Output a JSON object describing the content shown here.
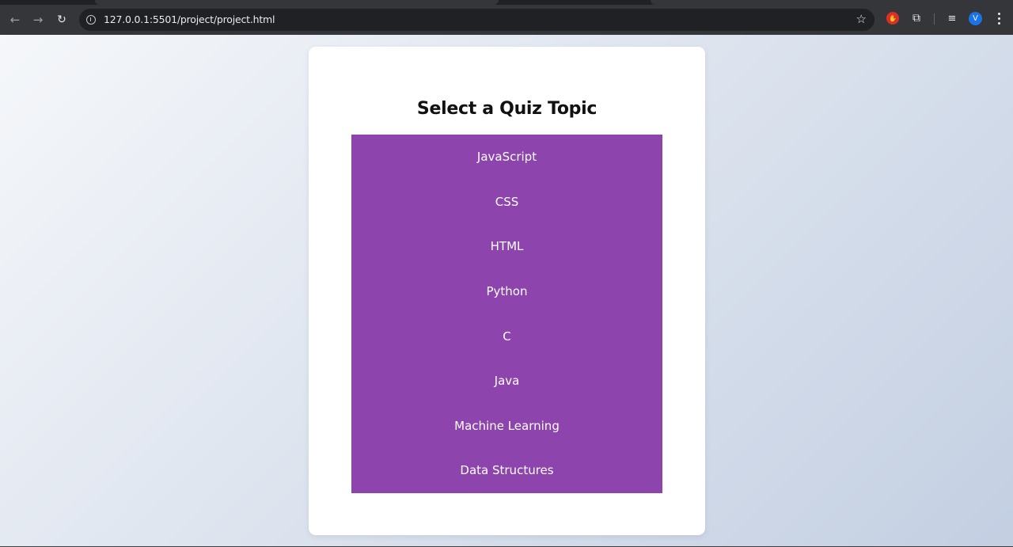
{
  "browser": {
    "url": "127.0.0.1:5501/project/project.html",
    "profile_initial": "V",
    "icons": {
      "back": "arrow-left-icon",
      "forward": "arrow-right-icon",
      "reload": "reload-icon",
      "site_info": "info-icon",
      "bookmark": "star-icon",
      "extension_red": "stop-hand-icon",
      "extensions": "puzzle-icon",
      "media": "media-queue-icon",
      "menu": "kebab-menu-icon"
    }
  },
  "page": {
    "title": "Select a Quiz Topic",
    "topics": [
      "JavaScript",
      "CSS",
      "HTML",
      "Python",
      "C",
      "Java",
      "Machine Learning",
      "Data Structures"
    ]
  },
  "colors": {
    "topic_background": "#8e44ad",
    "topic_text": "#ffffff",
    "card_background": "#ffffff",
    "page_gradient_start": "#f5f7fa",
    "page_gradient_end": "#c3cfe2"
  }
}
